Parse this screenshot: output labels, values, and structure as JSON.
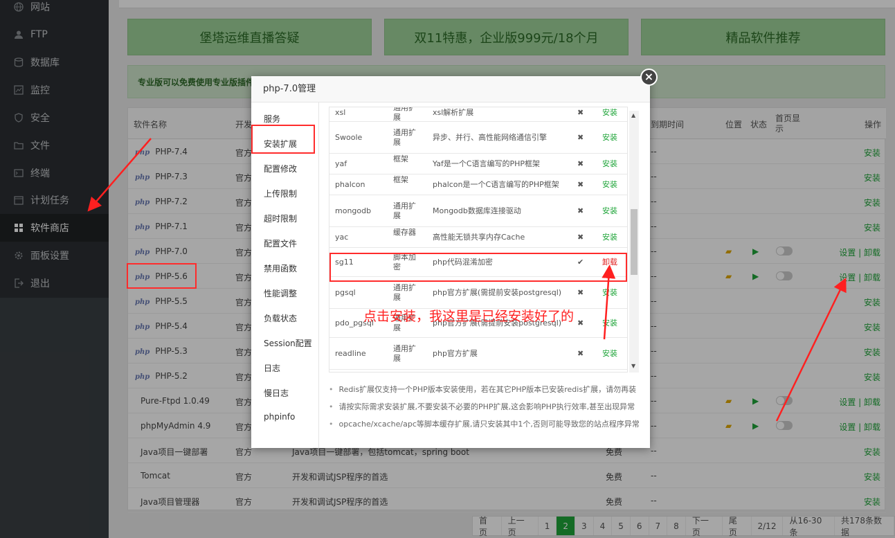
{
  "sidebar": {
    "items": [
      {
        "label": "网站",
        "icon": "globe-icon"
      },
      {
        "label": "FTP",
        "icon": "user-icon"
      },
      {
        "label": "数据库",
        "icon": "database-icon"
      },
      {
        "label": "监控",
        "icon": "monitor-icon"
      },
      {
        "label": "安全",
        "icon": "shield-icon"
      },
      {
        "label": "文件",
        "icon": "folder-icon"
      },
      {
        "label": "终端",
        "icon": "terminal-icon"
      },
      {
        "label": "计划任务",
        "icon": "calendar-icon"
      },
      {
        "label": "软件商店",
        "icon": "grid-icon"
      },
      {
        "label": "面板设置",
        "icon": "gear-icon"
      },
      {
        "label": "退出",
        "icon": "logout-icon"
      }
    ]
  },
  "banners": [
    "堡塔运维直播答疑",
    "双11特惠，企业版999元/18个月",
    "精品软件推荐"
  ],
  "promo": "专业版可以免费使用专业版插件",
  "table": {
    "headers": {
      "name": "软件名称",
      "dev": "开发",
      "expire": "到期时间",
      "location": "位置",
      "status": "状态",
      "homepage": "首页显示",
      "ops": "操作"
    },
    "rows": [
      {
        "name": "PHP-7.4",
        "dev": "官方",
        "expire": "--",
        "op": "安装"
      },
      {
        "name": "PHP-7.3",
        "dev": "官方",
        "expire": "--",
        "op": "安装"
      },
      {
        "name": "PHP-7.2",
        "dev": "官方",
        "expire": "--",
        "op": "安装"
      },
      {
        "name": "PHP-7.1",
        "dev": "官方",
        "expire": "--",
        "op": "安装"
      },
      {
        "name": "PHP-7.0",
        "dev": "官方",
        "expire": "--",
        "op": "设置 | 卸载"
      },
      {
        "name": "PHP-5.6",
        "dev": "官方",
        "expire": "--",
        "op": "设置 | 卸载"
      },
      {
        "name": "PHP-5.5",
        "dev": "官方",
        "expire": "--",
        "op": "安装"
      },
      {
        "name": "PHP-5.4",
        "dev": "官方",
        "expire": "--",
        "op": "安装"
      },
      {
        "name": "PHP-5.3",
        "dev": "官方",
        "expire": "--",
        "op": "安装"
      },
      {
        "name": "PHP-5.2",
        "dev": "官方",
        "expire": "--",
        "op": "安装"
      },
      {
        "name": "Pure-Ftpd 1.0.49",
        "dev": "官方",
        "expire": "--",
        "op": "设置 | 卸载"
      },
      {
        "name": "phpMyAdmin 4.9",
        "dev": "官方",
        "expire": "--",
        "op": "设置 | 卸载"
      },
      {
        "name": "Java项目一键部署",
        "dev": "官方",
        "desc": "Java项目一键部署，包括tomcat，spring boot",
        "price": "免费",
        "expire": "--",
        "op": "安装"
      },
      {
        "name": "Tomcat",
        "dev": "官方",
        "desc": "开发和调试JSP程序的首选",
        "price": "免费",
        "expire": "--",
        "op": "安装"
      },
      {
        "name": "Java项目管理器",
        "dev": "官方",
        "desc": "开发和调试JSP程序的首选",
        "price": "免费",
        "expire": "--",
        "op": "安装"
      }
    ]
  },
  "pager": [
    "首页",
    "上一页",
    "1",
    "2",
    "3",
    "4",
    "5",
    "6",
    "7",
    "8",
    "下一页",
    "尾页",
    "2/12",
    "从16-30条",
    "共178条数据"
  ],
  "modal": {
    "title": "php-7.0管理",
    "close": "×",
    "nav": [
      "服务",
      "安装扩展",
      "配置修改",
      "上传限制",
      "超时限制",
      "配置文件",
      "禁用函数",
      "性能调整",
      "负载状态",
      "Session配置",
      "日志",
      "慢日志",
      "phpinfo"
    ],
    "extensions": [
      {
        "name": "xsl",
        "type": "通用扩展",
        "desc": "xsl解析扩展",
        "mark": "✖",
        "action": "安装"
      },
      {
        "name": "Swoole",
        "type": "通用扩展",
        "desc": "异步、并行、高性能网络通信引擎",
        "mark": "✖",
        "action": "安装"
      },
      {
        "name": "yaf",
        "type": "框架",
        "desc": "Yaf是一个C语言编写的PHP框架",
        "mark": "✖",
        "action": "安装"
      },
      {
        "name": "phalcon",
        "type": "框架",
        "desc": "phalcon是一个C语言编写的PHP框架",
        "mark": "✖",
        "action": "安装"
      },
      {
        "name": "mongodb",
        "type": "通用扩展",
        "desc": "Mongodb数据库连接驱动",
        "mark": "✖",
        "action": "安装"
      },
      {
        "name": "yac",
        "type": "缓存器",
        "desc": "高性能无锁共享内存Cache",
        "mark": "✖",
        "action": "安装"
      },
      {
        "name": "sg11",
        "type": "脚本加密",
        "desc": "php代码混淆加密",
        "mark": "✔",
        "action": "卸载"
      },
      {
        "name": "pgsql",
        "type": "通用扩展",
        "desc": "php官方扩展(需提前安装postgresql)",
        "mark": "✖",
        "action": "安装"
      },
      {
        "name": "pdo_pgsql",
        "type": "通用扩展",
        "desc": "php官方扩展(需提前安装postgresql)",
        "mark": "✖",
        "action": "安装"
      },
      {
        "name": "readline",
        "type": "通用扩展",
        "desc": "php官方扩展",
        "mark": "✖",
        "action": "安装"
      }
    ],
    "notes": [
      "Redis扩展仅支持一个PHP版本安装使用，若在其它PHP版本已安装redis扩展，请勿再装",
      "请按实际需求安装扩展,不要安装不必要的PHP扩展,这会影响PHP执行效率,甚至出现异常",
      "opcache/xcache/apc等脚本缓存扩展,请只安装其中1个,否则可能导致您的站点程序异常"
    ]
  },
  "annotation": "点击安装，我这里是已经安装好了的"
}
